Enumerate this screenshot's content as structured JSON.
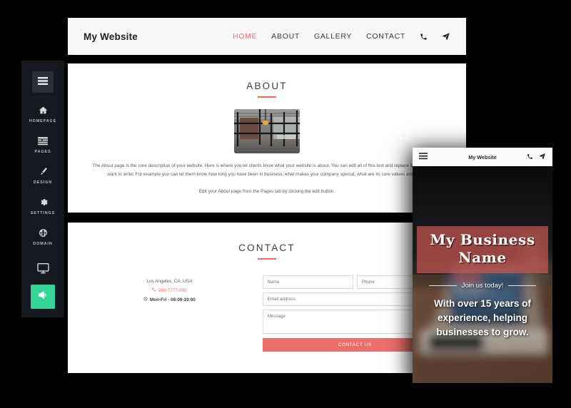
{
  "sidebar": {
    "menu_button_icon": "hamburger-icon",
    "items": [
      {
        "label": "HOMEPAGE",
        "icon": "home-icon"
      },
      {
        "label": "PAGES",
        "icon": "pages-list-icon"
      },
      {
        "label": "DESIGN",
        "icon": "paint-brush-icon"
      },
      {
        "label": "SETTINGS",
        "icon": "gear-icon"
      },
      {
        "label": "DOMAIN",
        "icon": "globe-icon"
      }
    ],
    "preview_icon": "monitor-icon",
    "promote_icon": "megaphone-icon",
    "colors": {
      "background": "#16191f",
      "promote": "#35d497",
      "label": "#b9bcc4"
    }
  },
  "desktop": {
    "header": {
      "brand": "My Website",
      "nav": [
        {
          "label": "HOME",
          "active": true
        },
        {
          "label": "ABOUT",
          "active": false
        },
        {
          "label": "GALLERY",
          "active": false
        },
        {
          "label": "CONTACT",
          "active": false
        }
      ],
      "phone_icon": "phone-icon",
      "directions_icon": "paper-plane-icon"
    },
    "about": {
      "title": "ABOUT",
      "image_alt": "office-interior-photo",
      "paragraph": "The About page is the core description of your website. Here is where you let clients know what your website is about. You can edit all of this text and replace it with what you want to write. For example you can let them know how long you have been in business, what makes your company special, what are its core values and more.",
      "note": "Edit your About page from the Pages tab by clicking the edit button."
    },
    "contact": {
      "title": "CONTACT",
      "address": "Los Angeles, CA, USA",
      "phone": "999-7777-000",
      "phone_icon": "phone-icon",
      "hours": "Mon-Fri - 08:00-19:00",
      "hours_icon": "clock-icon",
      "form": {
        "name_placeholder": "Name",
        "phone_placeholder": "Phone",
        "email_placeholder": "Email address",
        "message_placeholder": "Message",
        "submit_label": "CONTACT US"
      }
    },
    "colors": {
      "accent": "#ea6b63",
      "header_bg": "#f7f7f7",
      "button": "#e8716c"
    }
  },
  "mobile": {
    "header": {
      "menu_icon": "hamburger-icon",
      "title": "My Website",
      "phone_icon": "phone-icon",
      "directions_icon": "paper-plane-icon"
    },
    "hero": {
      "business_name": "My Business Name",
      "subtitle": "Join us today!",
      "tagline": "With over 15 years of experience, helping businesses to grow.",
      "banner_color": "#c85550",
      "background_alt": "laptop-on-wooden-desk-photo"
    }
  }
}
